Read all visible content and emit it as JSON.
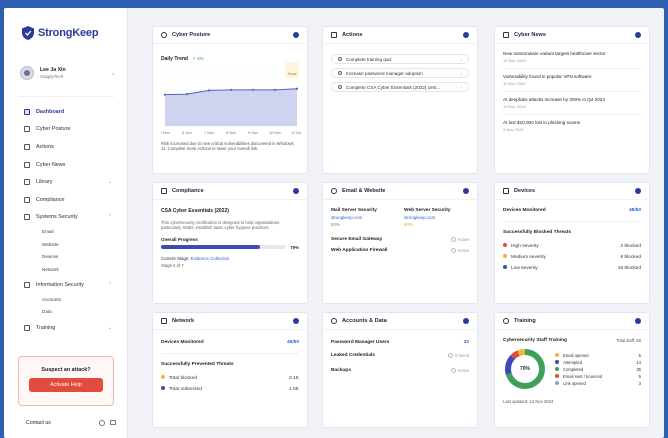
{
  "colors": {
    "brand": "#2c3a9c",
    "accent": "#e24b3d",
    "frame": "#2f5fb3",
    "chart_line": "#5563bf",
    "chart_fill": "#cfd3f0"
  },
  "app": {
    "name": "StrongKeep"
  },
  "user": {
    "name": "Lee Ja Xin",
    "role": "SupplyTech"
  },
  "sidebar": {
    "items": [
      {
        "label": "Dashboard",
        "icon": "grid-icon"
      },
      {
        "label": "Cyber Posture",
        "icon": "shield-icon"
      },
      {
        "label": "Actions",
        "icon": "list-icon"
      },
      {
        "label": "Cyber News",
        "icon": "newspaper-icon"
      },
      {
        "label": "Library",
        "icon": "book-icon"
      },
      {
        "label": "Compliance",
        "icon": "check-icon"
      },
      {
        "label": "Systems Security",
        "icon": "server-icon"
      },
      {
        "label": "Information Security",
        "icon": "lock-icon"
      },
      {
        "label": "Training",
        "icon": "cap-icon"
      }
    ],
    "systems_sub": [
      "Email",
      "Website",
      "Devices",
      "Network"
    ],
    "info_sub": [
      "Accounts",
      "Data"
    ],
    "attack": {
      "title": "Suspect an attack?",
      "button": "Activate Help"
    },
    "contact": "Contact us"
  },
  "posture": {
    "title": "Cyber Posture",
    "daily_trend_label": "Daily Trend",
    "trend_change": "↗ 4%",
    "score_badge": "Good",
    "note": "Risk increased due to new critical vulnerabilities discovered in Windows 11. Complete more Actions to lower your overall risk."
  },
  "chart_data": {
    "type": "area",
    "title": "Daily Trend",
    "categories": [
      "5 Nov",
      "6 Nov",
      "7 Nov",
      "8 Nov",
      "9 Nov",
      "10 Nov",
      "11 Nov"
    ],
    "values": [
      58,
      59,
      66,
      67,
      67,
      67,
      69
    ],
    "ylim": [
      0,
      100
    ]
  },
  "actions": {
    "title": "Actions",
    "items": [
      "Complete training quiz",
      "Increase password manager adoption",
      "Complete CSA Cyber Essentials (2022) certi..."
    ]
  },
  "news": {
    "title": "Cyber News",
    "items": [
      {
        "title": "New ransomware variant targets healthcare sector",
        "date": "12 Nov 2024"
      },
      {
        "title": "Vulnerability found in popular VPN software",
        "date": "11 Nov 2024"
      },
      {
        "title": "AI deepfake attacks increase by 300% in Q4 2024",
        "date": "10 Nov 2024"
      },
      {
        "title": "AI lost $10,000 lost in phishing scams",
        "date": "9 Nov 2024"
      }
    ]
  },
  "compliance": {
    "title": "Compliance",
    "cert": "CSA Cyber Essentials (2022)",
    "desc": "This cybersecurity certification is designed to help organisations, particularly SMEs, establish basic cyber hygiene practices.",
    "progress_label": "Overall Progress",
    "progress_value": "79%",
    "progress": 0.79,
    "stage_label": "Current Stage:",
    "stage_value": "Evidence Collection",
    "stage_of": "Stage 4 of 7"
  },
  "email": {
    "title": "Email & Website",
    "mail_label": "Mail Server Security",
    "mail_domain": "strongkeep.com",
    "mail_value": "92%",
    "web_label": "Web Server Security",
    "web_domain": "strongkeep.com",
    "web_value": "60%",
    "gateway_label": "Secure Email Gateway",
    "firewall_label": "Web Application Firewall",
    "status": "Active"
  },
  "devices": {
    "title": "Devices",
    "monitored_label": "Devices Monitored",
    "monitored_value": "48/50",
    "blocked_label": "Successfully Blocked Threats",
    "threats": [
      {
        "label": "High severity",
        "value": "2 blocked",
        "color": "#e24b3d"
      },
      {
        "label": "Medium severity",
        "value": "8 blocked",
        "color": "#f2b53a"
      },
      {
        "label": "Low severity",
        "value": "15 blocked",
        "color": "#3c4bb5"
      }
    ]
  },
  "network": {
    "title": "Network",
    "monitored_label": "Devices Monitored",
    "monitored_value": "45/50",
    "prevented_label": "Successfully Prevented Threats",
    "items": [
      {
        "label": "Total blocked",
        "value": "2.1K",
        "color": "#f2b53a"
      },
      {
        "label": "Total redirected",
        "value": "1.5K",
        "color": "#3c4bb5"
      }
    ]
  },
  "accounts": {
    "title": "Accounts & Data",
    "pm_label": "Password Manager Users",
    "pm_value": "32",
    "leaked_label": "Leaked Credentials",
    "leaked_value": "0 found",
    "backups_label": "Backups",
    "backups_value": "Active"
  },
  "training": {
    "title": "Training",
    "staff_label": "Cybersecurity Staff Training",
    "total_label": "Total staff: 50",
    "donut_value": "70%",
    "legend": [
      {
        "label": "Email opened",
        "value": "5",
        "color": "#f2b53a"
      },
      {
        "label": "Attempted",
        "value": "14",
        "color": "#3c4bb5"
      },
      {
        "label": "Completed",
        "value": "35",
        "color": "#3fa05a"
      },
      {
        "label": "Email sent / bounced",
        "value": "5",
        "color": "#e24b3d"
      },
      {
        "label": "Link opened",
        "value": "3",
        "color": "#9aa0c4"
      }
    ],
    "updated": "Last updated: 12 Nov 2024"
  }
}
